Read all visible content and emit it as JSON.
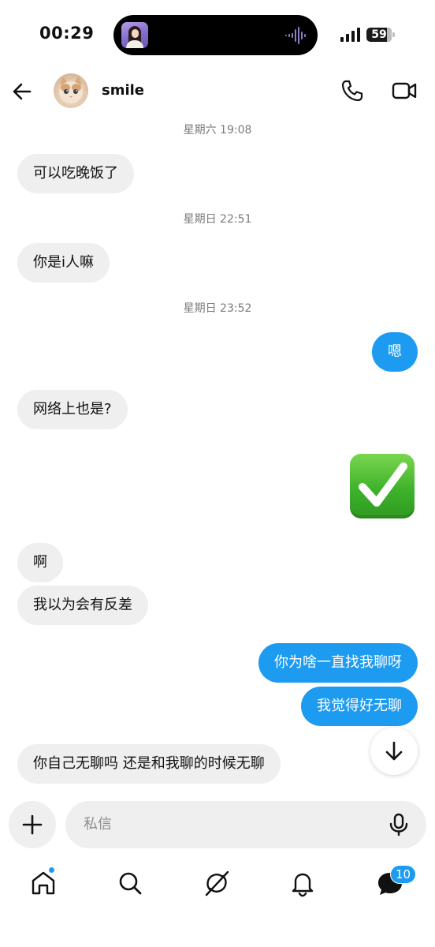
{
  "status_bar": {
    "time": "00:29",
    "battery": "59"
  },
  "header": {
    "contact_name": "smile"
  },
  "messages": [
    {
      "type": "timestamp",
      "text": "星期六 19:08"
    },
    {
      "type": "incoming",
      "text": "可以吃晚饭了"
    },
    {
      "type": "timestamp",
      "text": "星期日 22:51"
    },
    {
      "type": "incoming",
      "text": "你是i人嘛"
    },
    {
      "type": "timestamp",
      "text": "星期日 23:52"
    },
    {
      "type": "outgoing",
      "text": "嗯"
    },
    {
      "type": "incoming",
      "text": "网络上也是?"
    },
    {
      "type": "outgoing-emoji",
      "emoji": "check-mark-button"
    },
    {
      "type": "incoming",
      "text": "啊"
    },
    {
      "type": "incoming",
      "text": "我以为会有反差"
    },
    {
      "type": "outgoing",
      "text": "你为啥一直找我聊呀"
    },
    {
      "type": "outgoing",
      "text": "我觉得好无聊"
    },
    {
      "type": "incoming",
      "text": "你自己无聊吗 还是和我聊的时候无聊"
    }
  ],
  "composer": {
    "placeholder": "私信"
  },
  "tab_bar": {
    "messages_badge": "10"
  },
  "colors": {
    "accent": "#1d9bf0",
    "incoming_bubble": "#efefef",
    "check_emoji": "#3fb22b"
  }
}
